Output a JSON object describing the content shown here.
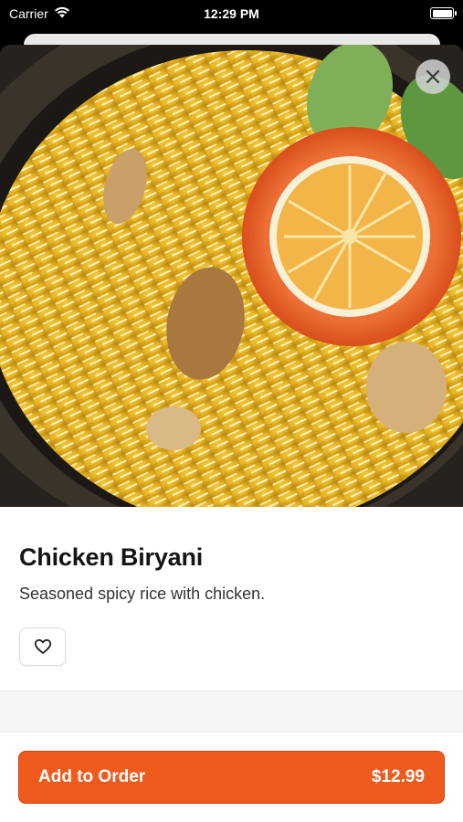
{
  "status_bar": {
    "carrier": "Carrier",
    "time": "12:29 PM",
    "battery_level": 1.0
  },
  "item": {
    "name": "Chicken Biryani",
    "description": "Seasoned spicy rice with chicken."
  },
  "actions": {
    "add_label": "Add to Order",
    "price": "$12.99"
  },
  "icons": {
    "close": "close-icon",
    "favorite": "heart-outline-icon",
    "wifi": "wifi-icon",
    "battery": "battery-icon"
  },
  "colors": {
    "accent": "#ef5a1d",
    "accent_border": "#c9470f",
    "title": "#151515",
    "text": "#333333"
  }
}
